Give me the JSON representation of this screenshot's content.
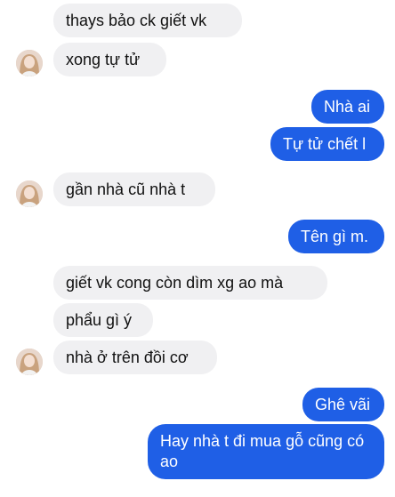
{
  "colors": {
    "incoming_bubble": "#f0f0f2",
    "outgoing_bubble": "#1f5fe6",
    "incoming_text": "#111111",
    "outgoing_text": "#ffffff"
  },
  "messages": [
    {
      "direction": "incoming",
      "text": "thays bảo ck giết vk"
    },
    {
      "direction": "incoming",
      "text": "xong tự tử",
      "avatar": "contact-avatar"
    },
    {
      "direction": "outgoing",
      "text": "Nhà ai"
    },
    {
      "direction": "outgoing",
      "text": "Tự tử chết l"
    },
    {
      "direction": "incoming",
      "text": "gần nhà cũ nhà t",
      "avatar": "contact-avatar"
    },
    {
      "direction": "outgoing",
      "text": "Tên gì m."
    },
    {
      "direction": "incoming",
      "text": "giết vk cong còn dìm xg ao mà"
    },
    {
      "direction": "incoming",
      "text": "phẩu gì ý"
    },
    {
      "direction": "incoming",
      "text": "nhà ở trên đồi cơ",
      "avatar": "contact-avatar"
    },
    {
      "direction": "outgoing",
      "text": "Ghê vãi"
    },
    {
      "direction": "outgoing",
      "text": "Hay nhà t đi mua gỗ cũng có ao"
    }
  ]
}
